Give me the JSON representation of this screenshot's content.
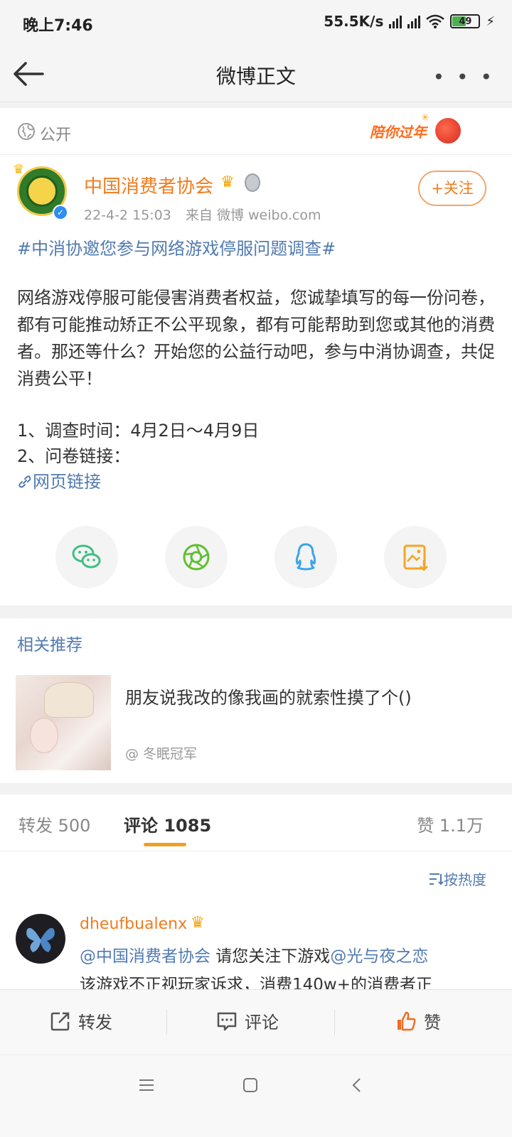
{
  "status_bar": {
    "time": "晚上7:46",
    "net_speed": "55.5K/s",
    "battery": "49"
  },
  "app_bar": {
    "title": "微博正文"
  },
  "visibility": {
    "label": "公开",
    "banner_text": "陪你过年"
  },
  "post": {
    "author": "中国消费者协会",
    "timestamp": "22-4-2 15:03",
    "source": "来自 微博 weibo.com",
    "follow_label": "+关注",
    "topic": "#中消协邀您参与网络游戏停服问题调查#",
    "body": "网络游戏停服可能侵害消费者权益，您诚挚填写的每一份问卷，都有可能推动矫正不公平现象，都有可能帮助到您或其他的消费者。那还等什么？开始您的公益行动吧，参与中消协调查，共促消费公平！",
    "item1": "1、调查时间：4月2日～4月9日",
    "item2": "2、问卷链接：",
    "link": "网页链接"
  },
  "related": {
    "title": "相关推荐",
    "item_text": "朋友说我改的像我画的就索性摸了个()",
    "item_author": "@ 冬眠冠军"
  },
  "tabs": {
    "repost": "转发 500",
    "comment": "评论 1085",
    "like": "赞 1.1万"
  },
  "sort_label": "按热度",
  "comment": {
    "name": "dheufbualenx",
    "mention1": "@中国消费者协会",
    "text1": " 请您关注下游戏",
    "mention2": "@光与夜之恋",
    "text2": "该游戏不正视玩家诉求，消费140w+的消费者正"
  },
  "action_bar": {
    "repost": "转发",
    "comment": "评论",
    "like": "赞"
  },
  "colors": {
    "accent_orange": "#f07c1e",
    "link_blue": "#517bb1",
    "tab_underline": "#f0a020"
  }
}
